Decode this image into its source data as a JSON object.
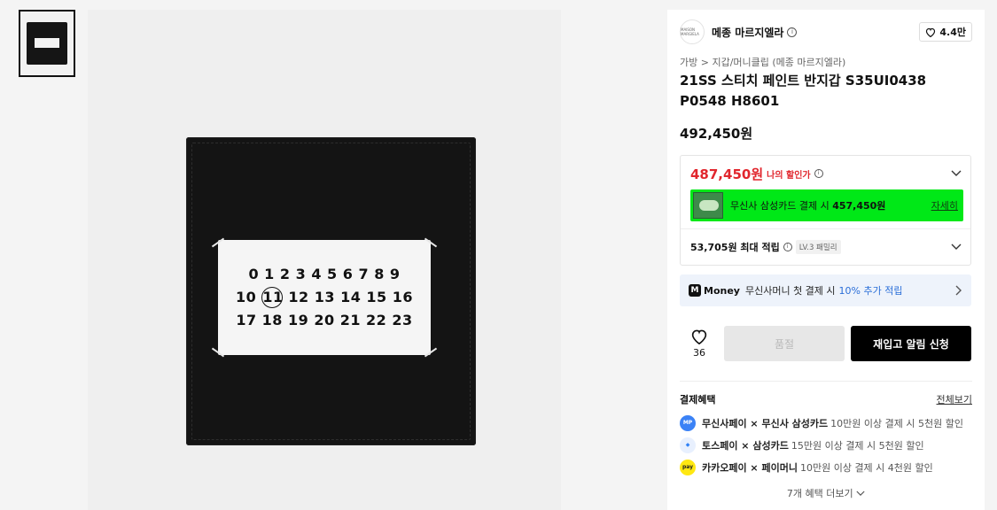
{
  "brand": {
    "name": "메종 마르지엘라",
    "likes": "4.4만",
    "logo_text": "MAISON MARGIELA"
  },
  "breadcrumb": {
    "cat1": "가방",
    "sep": ">",
    "cat2": "지갑/머니클립 (메종 마르지엘라)"
  },
  "product": {
    "title": "21SS 스티치 페인트 반지갑 S35UI0438 P0548 H8601",
    "price": "492,450원",
    "label_numbers": [
      [
        "0",
        "1",
        "2",
        "3",
        "4",
        "5",
        "6",
        "7",
        "8",
        "9"
      ],
      [
        "10",
        "11",
        "12",
        "13",
        "14",
        "15",
        "16"
      ],
      [
        "17",
        "18",
        "19",
        "20",
        "21",
        "22",
        "23"
      ]
    ]
  },
  "discount": {
    "price": "487,450원",
    "label": "나의 할인가"
  },
  "card_promo": {
    "text": "무신사 삼성카드 결제 시",
    "price": "457,450원",
    "link": "자세히"
  },
  "points": {
    "text": "53,705원 최대 적립",
    "badge": "LV.3 패밀리"
  },
  "money": {
    "logo": "M",
    "name": "Money",
    "text": "무신사머니 첫 결제 시",
    "highlight": "10% 추가 적립"
  },
  "actions": {
    "like_count": "36",
    "buy_label": "품절",
    "restock_label": "재입고 알림 신청"
  },
  "benefits": {
    "title": "결제혜택",
    "view_all": "전체보기",
    "items": [
      {
        "name": "무신사페이 × 무신사 삼성카드",
        "detail": "10만원 이상 결제 시 5천원 할인",
        "color": "#3b82f6"
      },
      {
        "name": "토스페이 × 삼성카드",
        "detail": "15만원 이상 결제 시 5천원 할인",
        "color": "#3182f6"
      },
      {
        "name": "카카오페이 × 페이머니",
        "detail": "10만원 이상 결제 시 4천원 할인",
        "color": "#ffe812"
      }
    ],
    "more": "7개 혜택 더보기"
  }
}
